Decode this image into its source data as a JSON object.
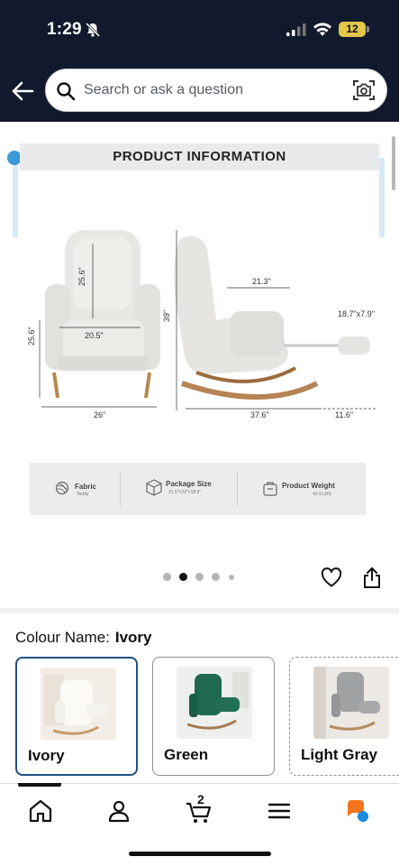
{
  "status_bar": {
    "time": "1:29",
    "battery": "12"
  },
  "search": {
    "placeholder": "Search or ask a question"
  },
  "product_image": {
    "banner_title": "PRODUCT INFORMATION",
    "dimensions": {
      "seat_height": "25.6\"",
      "back_height": "25.6\"",
      "seat_width": "20.5\"",
      "overall_width": "26\"",
      "overall_height": "39\"",
      "seat_depth": "21.3\"",
      "footrest": "18.7\"x7.9\"",
      "overall_depth": "37.6\"",
      "footrest_extension": "11.6\""
    },
    "specs": [
      {
        "title": "Fabric",
        "sub": "Teddy"
      },
      {
        "title": "Package Size",
        "sub": "31.5\"×22\"×18.9\""
      },
      {
        "title": "Product Weight",
        "sub": "43.9 LBS"
      }
    ]
  },
  "colour": {
    "label": "Colour Name:",
    "selected": "Ivory",
    "options": [
      {
        "label": "Ivory",
        "selected": true
      },
      {
        "label": "Green",
        "selected": false
      },
      {
        "label": "Light Gray",
        "selected": false
      }
    ]
  },
  "tabs": {
    "cart_count": "2"
  },
  "colors": {
    "header_bg": "#111a2c",
    "selected_border": "#1f4f80",
    "accent_orange": "#f3731c"
  }
}
